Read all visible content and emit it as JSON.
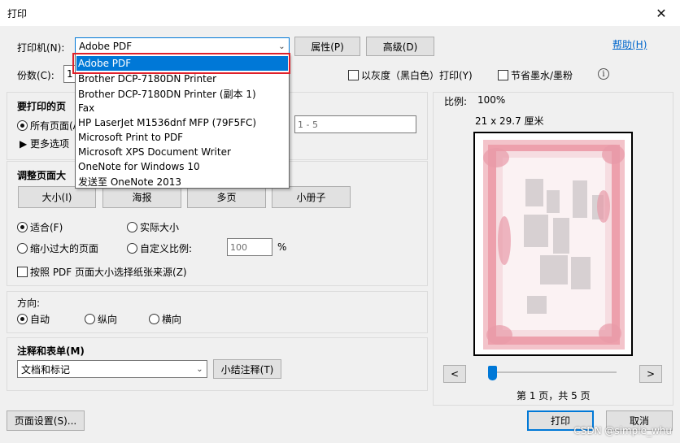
{
  "window": {
    "title": "打印",
    "close": "✕"
  },
  "printer": {
    "label": "打印机(N):",
    "selected": "Adobe PDF",
    "properties_btn": "属性(P)",
    "advanced_btn": "高级(D)",
    "help_link": "帮助(H)",
    "options": [
      "Adobe PDF",
      "Brother DCP-7180DN Printer",
      "Brother DCP-7180DN Printer (副本 1)",
      "Fax",
      "HP LaserJet M1536dnf MFP (79F5FC)",
      "Microsoft Print to PDF",
      "Microsoft XPS Document Writer",
      "OneNote for Windows 10",
      "发送至 OneNote 2013"
    ]
  },
  "copies": {
    "label": "份数(C):",
    "value": "1"
  },
  "grayscale": {
    "label": "以灰度（黑白色）打印(Y)"
  },
  "save_ink": {
    "label": "节省墨水/墨粉"
  },
  "info_icon": "i",
  "pages_section": {
    "title": "要打印的页",
    "all_pages": "所有页面(A)",
    "more_options": "▶ 更多选项",
    "range_value": "1 - 5"
  },
  "sizing_section": {
    "title": "调整页面大",
    "buttons": [
      "大小(I)",
      "海报",
      "多页",
      "小册子"
    ],
    "fit": "适合(F)",
    "actual_size": "实际大小",
    "shrink": "缩小过大的页面",
    "custom_scale": "自定义比例:",
    "scale_value": "100",
    "percent": "%",
    "choose_paper": "按照 PDF 页面大小选择纸张来源(Z)"
  },
  "orientation": {
    "title": "方向:",
    "auto": "自动",
    "portrait": "纵向",
    "landscape": "横向"
  },
  "comments_forms": {
    "title": "注释和表单(M)",
    "selected": "文档和标记",
    "summarize_btn": "小结注释(T)"
  },
  "preview": {
    "scale_label": "比例:",
    "scale_value": "100%",
    "paper_size": "21 x 29.7 厘米",
    "prev": "<",
    "next": ">",
    "page_info": "第 1 页，共 5 页",
    "current_page": 1,
    "total_pages": 5
  },
  "footer": {
    "page_setup_btn": "页面设置(S)...",
    "print_btn": "打印",
    "cancel_btn": "取消"
  },
  "watermark": "CSDN @simple_whu",
  "colors": {
    "accent": "#0078d7",
    "highlight": "#e0202a",
    "frame_pink": "#e88a98"
  }
}
